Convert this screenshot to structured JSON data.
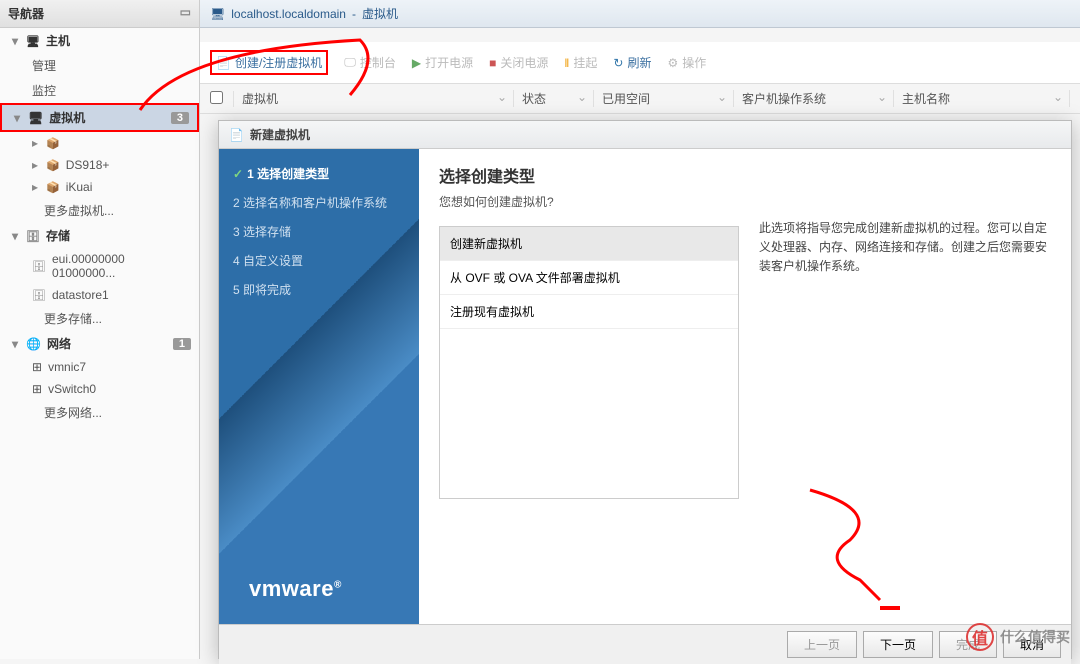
{
  "sidebar": {
    "title": "导航器",
    "host": {
      "label": "主机",
      "manage": "管理",
      "monitor": "监控"
    },
    "vm": {
      "label": "虚拟机",
      "badge": "3",
      "more": "更多虚拟机...",
      "items": [
        "",
        "DS918+",
        "iKuai"
      ]
    },
    "storage": {
      "label": "存储",
      "badge": "",
      "items": [
        "eui.00000000 01000000...",
        "datastore1"
      ],
      "more": "更多存储..."
    },
    "network": {
      "label": "网络",
      "badge": "1",
      "items": [
        "vmnic7",
        "vSwitch0"
      ],
      "more": "更多网络..."
    }
  },
  "breadcrumb": {
    "host": "localhost.localdomain",
    "section": "虚拟机"
  },
  "toolbar": {
    "create": "创建/注册虚拟机",
    "console": "控制台",
    "poweron": "打开电源",
    "poweroff": "关闭电源",
    "suspend": "挂起",
    "refresh": "刷新",
    "actions": "操作"
  },
  "table": {
    "cols": {
      "vm": "虚拟机",
      "status": "状态",
      "used": "已用空间",
      "guest": "客户机操作系统",
      "hostname": "主机名称"
    }
  },
  "modal": {
    "title": "新建虚拟机",
    "steps": [
      "1 选择创建类型",
      "2 选择名称和客户机操作系统",
      "3 选择存储",
      "4 自定义设置",
      "5 即将完成"
    ],
    "heading": "选择创建类型",
    "subtitle": "您想如何创建虚拟机?",
    "options": [
      "创建新虚拟机",
      "从 OVF 或 OVA 文件部署虚拟机",
      "注册现有虚拟机"
    ],
    "desc": "此选项将指导您完成创建新虚拟机的过程。您可以自定义处理器、内存、网络连接和存储。创建之后您需要安装客户机操作系统。",
    "buttons": {
      "prev": "上一页",
      "next": "下一页",
      "finish": "完成",
      "cancel": "取消"
    }
  },
  "logo": "vmware",
  "watermark": {
    "text": "什么值得买",
    "icon": "值"
  }
}
